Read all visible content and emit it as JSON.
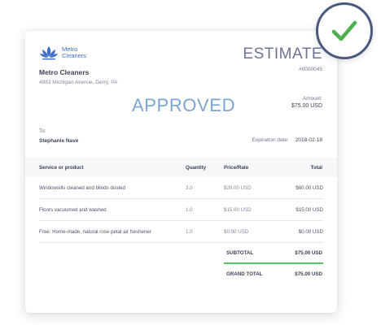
{
  "company": {
    "logo_line1": "Metro",
    "logo_line2": "Cleaners",
    "name": "Metro Cleaners",
    "address": "4983 Michigan Avenue, Derry, PA"
  },
  "estimate": {
    "title": "ESTIMATE",
    "number": "#0000045",
    "status": "APPROVED",
    "amount_label": "Amount:",
    "amount_value": "$75.00 USD"
  },
  "recipient": {
    "to_label": "To:",
    "name": "Stephanie Nave"
  },
  "expiration": {
    "label": "Expiration date:",
    "date": "2018-02-18"
  },
  "table": {
    "headers": [
      "Service or product",
      "Quantity",
      "Price/Rate",
      "Total"
    ],
    "rows": [
      {
        "service": "Windowsills cleaned and blinds dusted",
        "quantity": "3.0",
        "price": "$20.00 USD",
        "total": "$60.00 USD"
      },
      {
        "service": "Floors vacuumed and washed",
        "quantity": "1.0",
        "price": "$15.00 USD",
        "total": "$15.00 USD"
      },
      {
        "service": "Free: Home-made, natural rose petal air freshener",
        "quantity": "1.0",
        "price": "$0.00 USD",
        "total": "$0.00 USD"
      }
    ]
  },
  "totals": {
    "subtotal_label": "SUBTOTAL",
    "subtotal_value": "$75.00 USD",
    "grand_total_label": "GRAND TOTAL",
    "grand_total_value": "$75.00 USD"
  },
  "colors": {
    "brand": "#3f6ec7",
    "approved": "#7aa5d6",
    "check": "#4caf50",
    "accent_line": "#4fc86b"
  },
  "icons": {
    "logo": "lotus-logo-icon",
    "badge": "checkmark-icon"
  }
}
